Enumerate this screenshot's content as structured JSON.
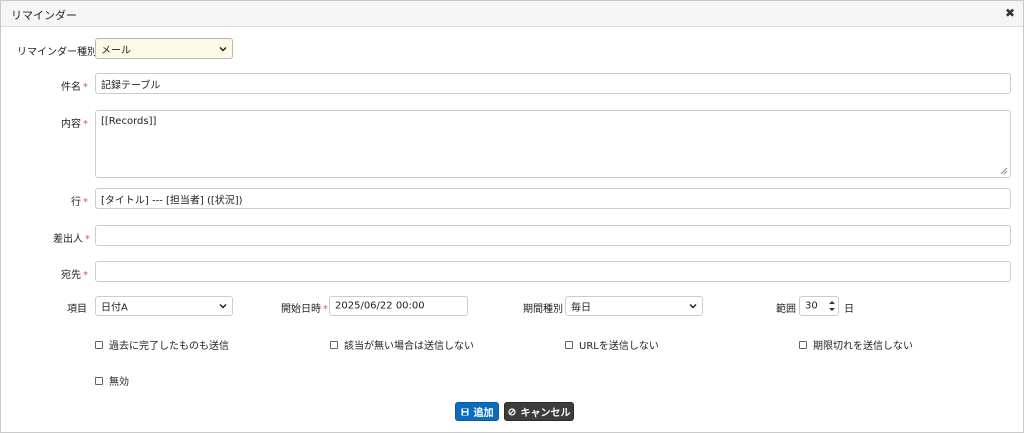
{
  "dialog": {
    "title": "リマインダー"
  },
  "form": {
    "type_label": "リマインダー種別",
    "type_value": "メール",
    "subject_label": "件名",
    "subject_value": "記録テーブル",
    "body_label": "内容",
    "body_value": "[[Records]]",
    "line_label": "行",
    "line_value": "[タイトル] --- [担当者] ([状況])",
    "sender_label": "差出人",
    "sender_value": "",
    "to_label": "宛先",
    "to_value": "",
    "required_mark": "*",
    "item_label": "項目",
    "item_value": "日付A",
    "start_label": "開始日時",
    "start_value": "2025/06/22 00:00",
    "period_label": "期間種別",
    "period_value": "毎日",
    "range_label": "範囲",
    "range_value": "30",
    "range_unit": "日",
    "checkboxes": [
      {
        "label": "過去に完了したものも送信",
        "checked": false
      },
      {
        "label": "該当が無い場合は送信しない",
        "checked": false
      },
      {
        "label": "URLを送信しない",
        "checked": false
      },
      {
        "label": "期限切れを送信しない",
        "checked": false
      },
      {
        "label": "無効",
        "checked": false
      }
    ]
  },
  "buttons": {
    "add_label": "追加",
    "cancel_label": "キャンセル",
    "add_color": "#0d6dbd",
    "cancel_color": "#3d3d3d"
  },
  "icons": {
    "close": "close-icon",
    "save": "save-icon",
    "cancel": "ban-icon"
  }
}
